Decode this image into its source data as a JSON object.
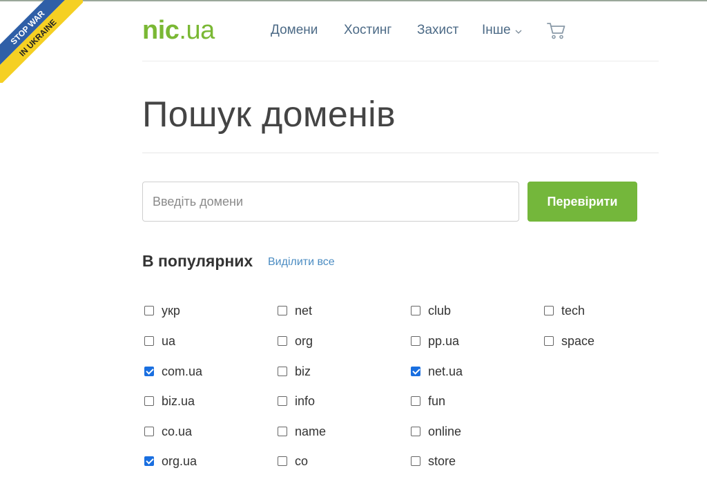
{
  "ribbon": {
    "line1": "STOP WAR",
    "line2": "IN UKRAINE",
    "blue": "#2f5fa7",
    "yellow": "#f5d023"
  },
  "header": {
    "logo": {
      "name": "nic",
      "tld": ".ua"
    },
    "nav": [
      {
        "label": "Домени"
      },
      {
        "label": "Хостинг"
      },
      {
        "label": "Захист"
      },
      {
        "label": "Інше",
        "icon": "chevron-down-icon"
      }
    ],
    "cart_icon": "cart-icon"
  },
  "page": {
    "title": "Пошук доменів"
  },
  "search": {
    "placeholder": "Введіть домени",
    "value": "",
    "button_label": "Перевірити"
  },
  "popular": {
    "title": "В популярних",
    "select_all": "Виділити все",
    "columns": [
      [
        {
          "label": "укр",
          "checked": false
        },
        {
          "label": "ua",
          "checked": false
        },
        {
          "label": "com.ua",
          "checked": true
        },
        {
          "label": "biz.ua",
          "checked": false
        },
        {
          "label": "co.ua",
          "checked": false
        },
        {
          "label": "org.ua",
          "checked": true
        }
      ],
      [
        {
          "label": "net",
          "checked": false
        },
        {
          "label": "org",
          "checked": false
        },
        {
          "label": "biz",
          "checked": false
        },
        {
          "label": "info",
          "checked": false
        },
        {
          "label": "name",
          "checked": false
        },
        {
          "label": "co",
          "checked": false
        }
      ],
      [
        {
          "label": "club",
          "checked": false
        },
        {
          "label": "pp.ua",
          "checked": false
        },
        {
          "label": "net.ua",
          "checked": true
        },
        {
          "label": "fun",
          "checked": false
        },
        {
          "label": "online",
          "checked": false
        },
        {
          "label": "store",
          "checked": false
        }
      ],
      [
        {
          "label": "tech",
          "checked": false
        },
        {
          "label": "space",
          "checked": false
        }
      ]
    ]
  },
  "colors": {
    "brand_green": "#7ab834",
    "button_green": "#74b73b",
    "link_blue": "#4b8cc2",
    "nav_blue": "#4c6a86",
    "checkbox_blue": "#1a6fe0"
  }
}
